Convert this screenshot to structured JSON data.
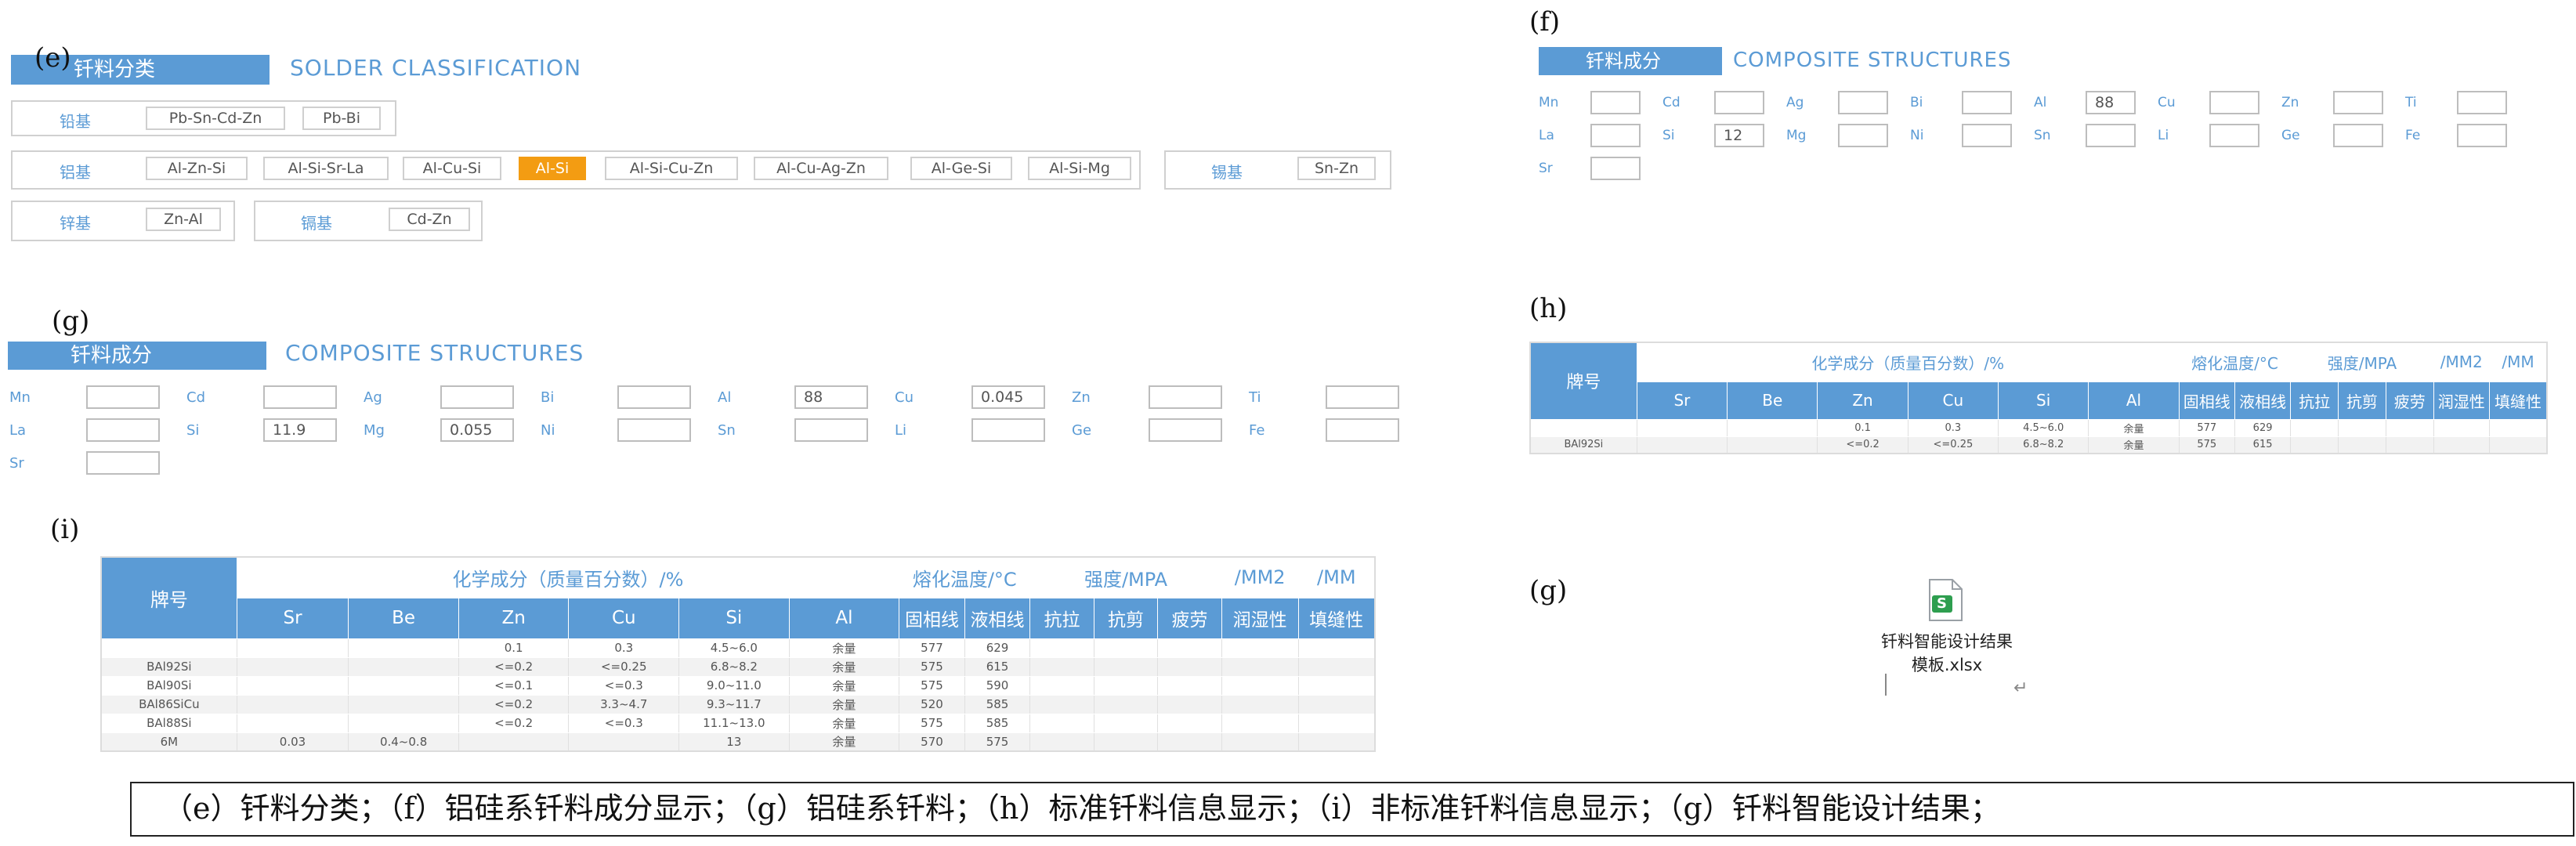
{
  "panel_e": {
    "label": "(e)",
    "title_cn": "钎料分类",
    "title_en": "SOLDER CLASSIFICATION",
    "groups": [
      {
        "label": "铅基",
        "items": [
          "Pb-Sn-Cd-Zn",
          "Pb-Bi"
        ]
      },
      {
        "label": "铝基",
        "items": [
          "Al-Zn-Si",
          "Al-Si-Sr-La",
          "Al-Cu-Si",
          "Al-Si",
          "Al-Si-Cu-Zn",
          "Al-Cu-Ag-Zn",
          "Al-Ge-Si",
          "Al-Si-Mg"
        ],
        "selected": "Al-Si"
      },
      {
        "label": "锡基",
        "items": [
          "Sn-Zn"
        ]
      },
      {
        "label": "锌基",
        "items": [
          "Zn-Al"
        ]
      },
      {
        "label": "镉基",
        "items": [
          "Cd-Zn"
        ]
      }
    ]
  },
  "panel_f": {
    "label": "(f)",
    "title_cn": "钎料成分",
    "title_en": "COMPOSITE STRUCTURES",
    "fields": [
      {
        "el": "Mn",
        "value": ""
      },
      {
        "el": "Cd",
        "value": ""
      },
      {
        "el": "Ag",
        "value": ""
      },
      {
        "el": "Bi",
        "value": ""
      },
      {
        "el": "Al",
        "value": "88"
      },
      {
        "el": "Cu",
        "value": ""
      },
      {
        "el": "Zn",
        "value": ""
      },
      {
        "el": "Ti",
        "value": ""
      },
      {
        "el": "La",
        "value": ""
      },
      {
        "el": "Si",
        "value": "12"
      },
      {
        "el": "Mg",
        "value": ""
      },
      {
        "el": "Ni",
        "value": ""
      },
      {
        "el": "Sn",
        "value": ""
      },
      {
        "el": "Li",
        "value": ""
      },
      {
        "el": "Ge",
        "value": ""
      },
      {
        "el": "Fe",
        "value": ""
      },
      {
        "el": "Sr",
        "value": ""
      }
    ]
  },
  "panel_g": {
    "label": "(g)",
    "title_cn": "钎料成分",
    "title_en": "COMPOSITE STRUCTURES",
    "fields": [
      {
        "el": "Mn",
        "value": ""
      },
      {
        "el": "Cd",
        "value": ""
      },
      {
        "el": "Ag",
        "value": ""
      },
      {
        "el": "Bi",
        "value": ""
      },
      {
        "el": "Al",
        "value": "88"
      },
      {
        "el": "Cu",
        "value": "0.045"
      },
      {
        "el": "Zn",
        "value": ""
      },
      {
        "el": "Ti",
        "value": ""
      },
      {
        "el": "La",
        "value": ""
      },
      {
        "el": "Si",
        "value": "11.9"
      },
      {
        "el": "Mg",
        "value": "0.055"
      },
      {
        "el": "Ni",
        "value": ""
      },
      {
        "el": "Sn",
        "value": ""
      },
      {
        "el": "Li",
        "value": ""
      },
      {
        "el": "Ge",
        "value": ""
      },
      {
        "el": "Fe",
        "value": ""
      },
      {
        "el": "Sr",
        "value": ""
      }
    ]
  },
  "table_headers": {
    "grade": "牌号",
    "composition": "化学成分（质量百分数）/%",
    "melting": "熔化温度/°C",
    "strength": "强度/MPA",
    "mm2": "/MM2",
    "mm": "/MM",
    "elements": [
      "Sr",
      "Be",
      "Zn",
      "Cu",
      "Si",
      "Al"
    ],
    "melt_cols": [
      "固相线",
      "液相线"
    ],
    "strength_cols": [
      "抗拉",
      "抗剪",
      "疲劳"
    ],
    "wet": "润湿性",
    "fill": "填缝性"
  },
  "panel_h": {
    "label": "(h)",
    "rows": [
      [
        "",
        "",
        "",
        "0.1",
        "0.3",
        "4.5~6.0",
        "余量",
        "577",
        "629",
        "",
        "",
        "",
        "",
        ""
      ],
      [
        "BAl92Si",
        "",
        "",
        "<=0.2",
        "<=0.25",
        "6.8~8.2",
        "余量",
        "575",
        "615",
        "",
        "",
        "",
        "",
        ""
      ]
    ]
  },
  "panel_i": {
    "label": "(i)",
    "rows": [
      [
        "",
        "",
        "",
        "0.1",
        "0.3",
        "4.5~6.0",
        "余量",
        "577",
        "629",
        "",
        "",
        "",
        "",
        ""
      ],
      [
        "BAl92Si",
        "",
        "",
        "<=0.2",
        "<=0.25",
        "6.8~8.2",
        "余量",
        "575",
        "615",
        "",
        "",
        "",
        "",
        ""
      ],
      [
        "BAl90Si",
        "",
        "",
        "<=0.1",
        "<=0.3",
        "9.0~11.0",
        "余量",
        "575",
        "590",
        "",
        "",
        "",
        "",
        ""
      ],
      [
        "BAl86SiCu",
        "",
        "",
        "<=0.2",
        "3.3~4.7",
        "9.3~11.7",
        "余量",
        "520",
        "585",
        "",
        "",
        "",
        "",
        ""
      ],
      [
        "BAl88Si",
        "",
        "",
        "<=0.2",
        "<=0.3",
        "11.1~13.0",
        "余量",
        "575",
        "585",
        "",
        "",
        "",
        "",
        ""
      ],
      [
        "6M",
        "0.03",
        "0.4~0.8",
        "",
        "",
        "13",
        "余量",
        "570",
        "575",
        "",
        "",
        "",
        "",
        ""
      ]
    ]
  },
  "panel_g2": {
    "label": "(g)",
    "file_name_line1": "钎料智能设计结果",
    "file_name_line2": "模板.xlsx",
    "file_icon_glyph": "S",
    "file_icon": "spreadsheet-file-icon",
    "return_mark": "↵"
  },
  "caption": "（e）钎料分类；（f）铝硅系钎料成分显示；（g）铝硅系钎料；（h）标准钎料信息显示；（i）非标准钎料信息显示；（g）钎料智能设计结果；"
}
